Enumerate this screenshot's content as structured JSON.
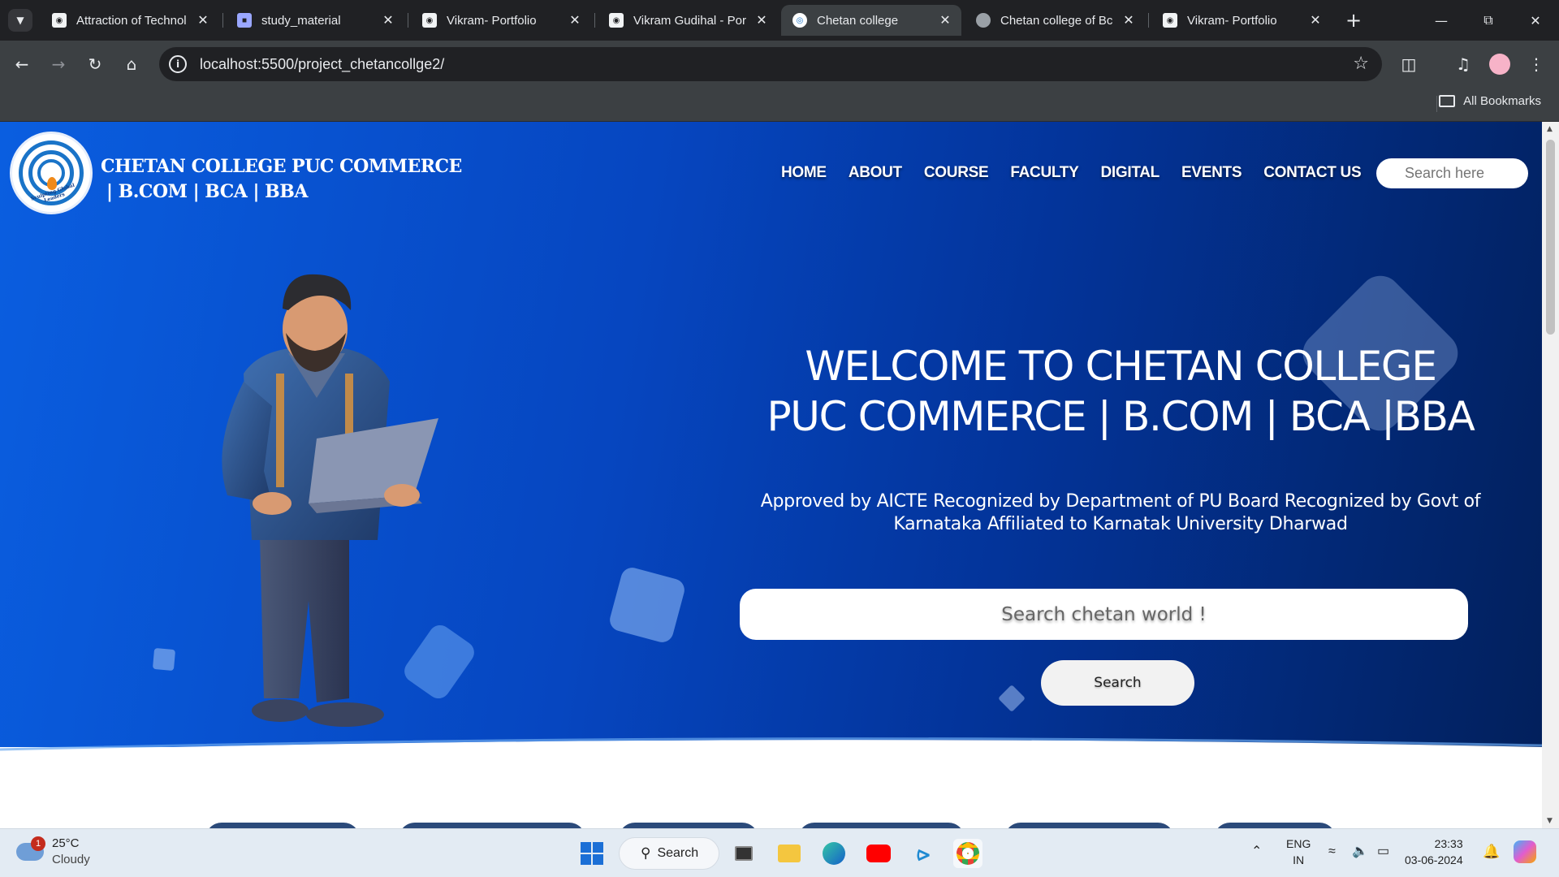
{
  "browser": {
    "tabs": [
      {
        "title": "Attraction of Technol",
        "favicon": "github-icon",
        "active": false
      },
      {
        "title": "study_material",
        "favicon": "doc-icon",
        "active": false
      },
      {
        "title": "Vikram- Portfolio",
        "favicon": "page-icon",
        "active": false
      },
      {
        "title": "Vikram Gudihal - Por",
        "favicon": "page-icon",
        "active": false
      },
      {
        "title": "Chetan college",
        "favicon": "college-logo-icon",
        "active": true
      },
      {
        "title": "Chetan college of Bc",
        "favicon": "globe-icon",
        "active": false
      },
      {
        "title": "Vikram- Portfolio",
        "favicon": "page-icon",
        "active": false
      }
    ],
    "url": "localhost:5500/project_chetancollge2/",
    "bookmarks_label": "All Bookmarks"
  },
  "site": {
    "brand_line1": "CHETAN COLLEGE PUC COMMERCE",
    "brand_line2": "| B.COM | BCA | BBA",
    "logo_text": "Sculpting Global Leaders",
    "nav": [
      "HOME",
      "ABOUT",
      "COURSE",
      "FACULTY",
      "DIGITAL",
      "EVENTS",
      "CONTACT US"
    ],
    "nav_search_placeholder": "Search here",
    "headline_line1": "WELCOME TO CHETAN COLLEGE",
    "headline_line2": "PUC COMMERCE | B.COM | BCA |BBA",
    "subline": "Approved by AICTE Recognized by Department of PU Board Recognized by Govt of Karnataka Affiliated to Karnatak University Dharwad",
    "hero_search_placeholder": "Search chetan world !",
    "hero_search_button": "Search",
    "colors": {
      "hero_start": "#0a5ee0",
      "hero_end": "#02205c",
      "accent": "#1a74c8"
    }
  },
  "taskbar": {
    "weather_temp": "25°C",
    "weather_desc": "Cloudy",
    "weather_badge": "1",
    "search_label": "Search",
    "lang_top": "ENG",
    "lang_bottom": "IN",
    "time": "23:33",
    "date": "03-06-2024"
  }
}
